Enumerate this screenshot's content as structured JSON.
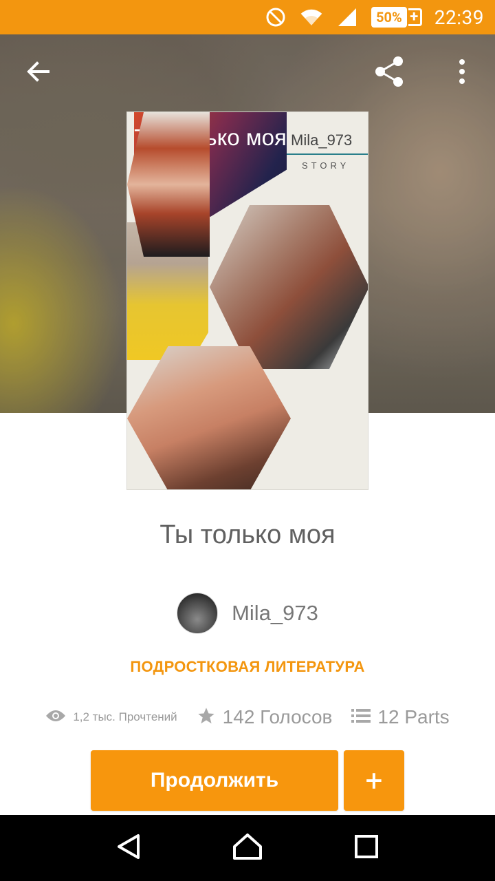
{
  "status_bar": {
    "battery": "50%",
    "time": "22:39",
    "icons": [
      "do-not-disturb-icon",
      "wifi-icon",
      "signal-icon",
      "battery-charging-icon"
    ]
  },
  "header": {
    "back_icon": "arrow-left-icon",
    "share_icon": "share-icon",
    "more_icon": "more-vert-icon"
  },
  "cover": {
    "title": "Ты только моя",
    "author": "Mila_973",
    "subtitle": "STORY"
  },
  "book": {
    "title": "Ты только моя",
    "author": "Mila_973",
    "category": "ПОДРОСТКОВАЯ ЛИТЕРАТУРА"
  },
  "stats": {
    "reads": "1,2 тыс. Прочтений",
    "votes": "142 Голосов",
    "parts": "12 Parts"
  },
  "actions": {
    "continue_label": "Продолжить",
    "add_label": "+"
  },
  "colors": {
    "accent": "#f3960f",
    "text_gray": "#606060"
  }
}
